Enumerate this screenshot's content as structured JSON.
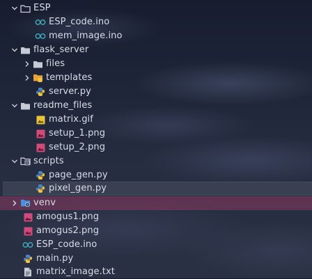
{
  "explorer": {
    "items": [
      {
        "label": "ESP",
        "kind": "folder",
        "state": "open"
      },
      {
        "label": "ESP_code.ino",
        "kind": "arduino"
      },
      {
        "label": "mem_image.ino",
        "kind": "arduino"
      },
      {
        "label": "flask_server",
        "kind": "folder",
        "state": "open"
      },
      {
        "label": "files",
        "kind": "folder",
        "state": "closed"
      },
      {
        "label": "templates",
        "kind": "folder",
        "state": "closed"
      },
      {
        "label": "server.py",
        "kind": "python"
      },
      {
        "label": "readme_files",
        "kind": "folder",
        "state": "open"
      },
      {
        "label": "matrix.gif",
        "kind": "image-gif"
      },
      {
        "label": "setup_1.png",
        "kind": "image-png"
      },
      {
        "label": "setup_2.png",
        "kind": "image-png"
      },
      {
        "label": "scripts",
        "kind": "folder",
        "state": "open"
      },
      {
        "label": "page_gen.py",
        "kind": "python"
      },
      {
        "label": "pixel_gen.py",
        "kind": "python",
        "selected": true
      },
      {
        "label": "venv",
        "kind": "folder",
        "state": "closed",
        "hovered": true
      },
      {
        "label": "amogus1.png",
        "kind": "image-png"
      },
      {
        "label": "amogus2.png",
        "kind": "image-png"
      },
      {
        "label": "ESP_code.ino",
        "kind": "arduino"
      },
      {
        "label": "main.py",
        "kind": "python"
      },
      {
        "label": "matrix_image.txt",
        "kind": "text"
      }
    ]
  },
  "colors": {
    "folder": "#c6cbd6",
    "arduino": "#3ea8b8",
    "python_blue": "#4a84c4",
    "python_yellow": "#f0c43c",
    "png": "#d04a7a",
    "gif": "#e8c43a",
    "venv": "#4a8fe0",
    "hover_row": "#8c3a60"
  }
}
